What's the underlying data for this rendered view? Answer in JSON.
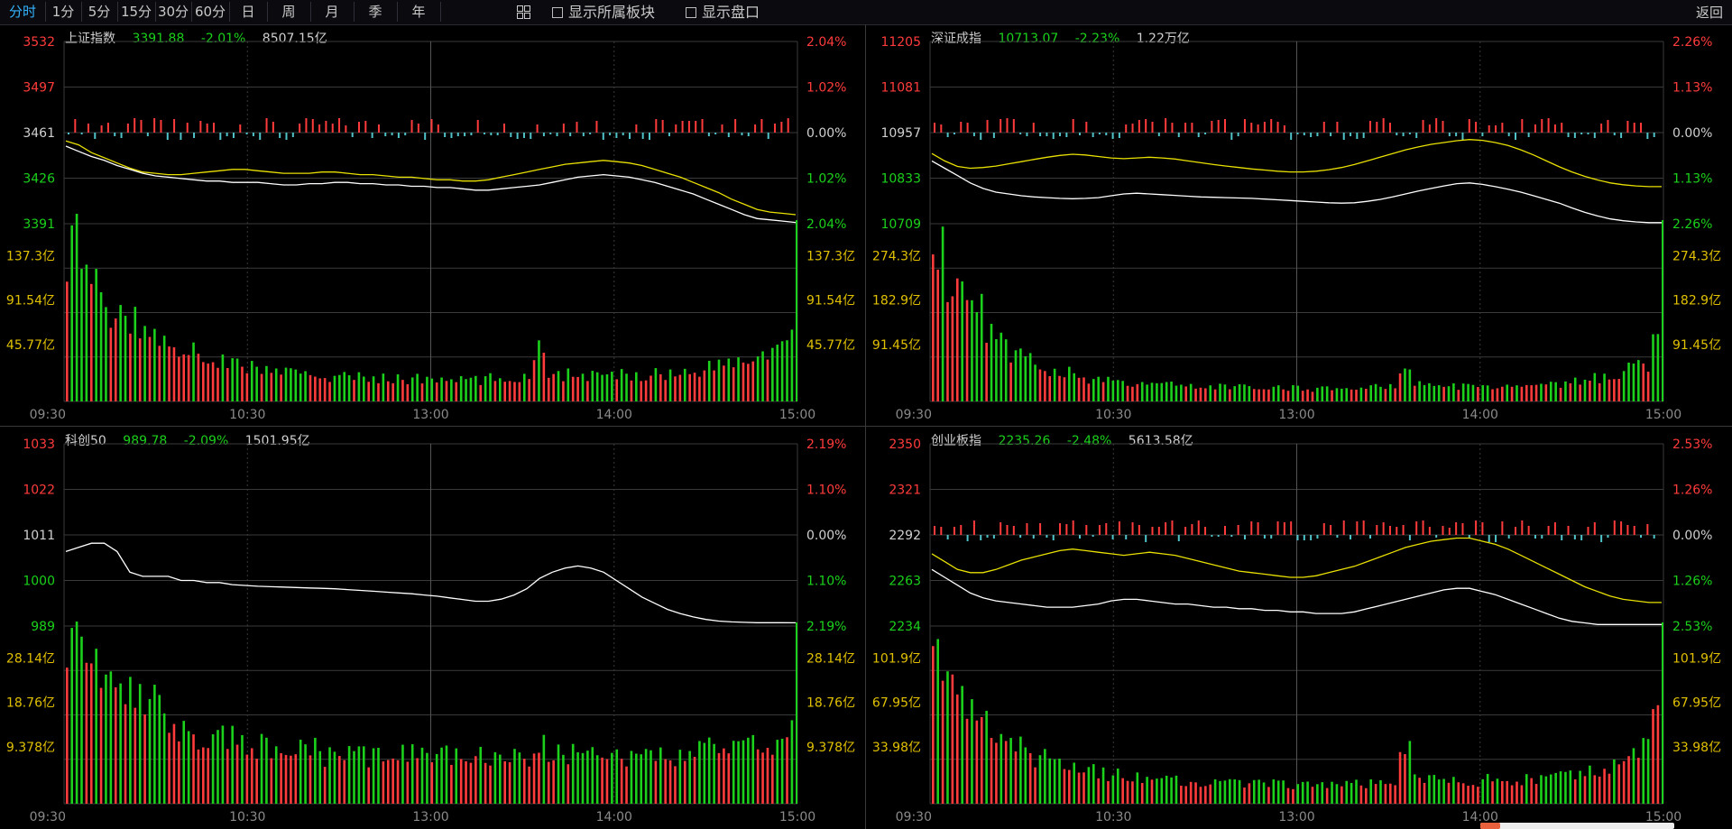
{
  "toolbar": {
    "periods": [
      "分时",
      "1分",
      "5分",
      "15分",
      "30分",
      "60分",
      "日",
      "周",
      "月",
      "季",
      "年"
    ],
    "active": "分时",
    "show_sector_label": "显示所属板块",
    "show_panel_label": "显示盘口",
    "back_label": "返回"
  },
  "colors": {
    "up": "#ff3b3b",
    "down": "#1bd11b",
    "neutral": "#d0d0d0",
    "yellow": "#e8e000",
    "white_line": "#ffffff",
    "bar_down": "#4fc3c8",
    "vol_label": "#e0c000",
    "time_label": "#8a8a8a",
    "grid": "#3a3a3a"
  },
  "panels": [
    {
      "name": "上证指数",
      "price": "3391.88",
      "change": "-2.01%",
      "amount": "8507.15亿",
      "price_labels": [
        "3532",
        "3497",
        "3461",
        "3426",
        "3391"
      ],
      "pct_labels": [
        "2.04%",
        "1.02%",
        "0.00%",
        "1.02%",
        "2.04%"
      ],
      "vol_labels": [
        "137.3亿",
        "91.54亿",
        "45.77亿"
      ],
      "time_labels": [
        "09:30",
        "10:30",
        "13:00",
        "14:00",
        "15:00"
      ],
      "has_yellow": true,
      "has_bars": true,
      "white_line": [
        3451,
        3447,
        3443,
        3440,
        3436,
        3433,
        3430,
        3428,
        3427,
        3426,
        3425,
        3424,
        3424,
        3423,
        3423,
        3423,
        3422,
        3421,
        3421,
        3422,
        3422,
        3423,
        3423,
        3422,
        3422,
        3421,
        3421,
        3420,
        3420,
        3419,
        3419,
        3418,
        3417,
        3417,
        3418,
        3419,
        3420,
        3421,
        3423,
        3425,
        3427,
        3428,
        3429,
        3428,
        3427,
        3425,
        3423,
        3420,
        3417,
        3414,
        3410,
        3406,
        3402,
        3398,
        3395,
        3394,
        3393,
        3392
      ],
      "yellow_line": [
        3455,
        3452,
        3446,
        3442,
        3438,
        3434,
        3431,
        3430,
        3429,
        3429,
        3430,
        3431,
        3432,
        3433,
        3433,
        3432,
        3431,
        3430,
        3430,
        3430,
        3431,
        3431,
        3430,
        3429,
        3429,
        3428,
        3427,
        3427,
        3426,
        3425,
        3425,
        3424,
        3424,
        3425,
        3427,
        3429,
        3431,
        3433,
        3435,
        3437,
        3438,
        3439,
        3440,
        3439,
        3438,
        3436,
        3433,
        3430,
        3427,
        3423,
        3419,
        3415,
        3410,
        3406,
        3402,
        3400,
        3399,
        3398
      ],
      "volume": [
        120,
        95,
        82,
        70,
        64,
        58,
        52,
        48,
        44,
        40,
        36,
        32,
        30,
        28,
        26,
        24,
        22,
        22,
        20,
        20,
        19,
        19,
        18,
        18,
        18,
        17,
        17,
        17,
        16,
        16,
        16,
        16,
        16,
        17,
        17,
        18,
        19,
        40,
        22,
        20,
        19,
        19,
        19,
        19,
        20,
        20,
        21,
        21,
        22,
        22,
        24,
        26,
        28,
        30,
        32,
        35,
        40,
        44
      ]
    },
    {
      "name": "深证成指",
      "price": "10713.07",
      "change": "-2.23%",
      "amount": "1.22万亿",
      "price_labels": [
        "11205",
        "11081",
        "10957",
        "10833",
        "10709"
      ],
      "pct_labels": [
        "2.26%",
        "1.13%",
        "0.00%",
        "1.13%",
        "2.26%"
      ],
      "vol_labels": [
        "274.3亿",
        "182.9亿",
        "91.45亿"
      ],
      "time_labels": [
        "09:30",
        "10:30",
        "13:00",
        "14:00",
        "15:00"
      ],
      "has_yellow": true,
      "has_bars": true,
      "white_line": [
        10880,
        10860,
        10840,
        10820,
        10805,
        10795,
        10790,
        10785,
        10782,
        10780,
        10778,
        10777,
        10778,
        10780,
        10785,
        10790,
        10792,
        10790,
        10788,
        10786,
        10784,
        10782,
        10781,
        10780,
        10779,
        10778,
        10776,
        10774,
        10772,
        10770,
        10768,
        10766,
        10765,
        10766,
        10770,
        10775,
        10782,
        10790,
        10798,
        10805,
        10812,
        10818,
        10820,
        10816,
        10810,
        10803,
        10795,
        10785,
        10775,
        10765,
        10752,
        10740,
        10730,
        10722,
        10717,
        10714,
        10712,
        10712
      ],
      "yellow_line": [
        10900,
        10880,
        10865,
        10860,
        10862,
        10866,
        10872,
        10878,
        10884,
        10890,
        10895,
        10898,
        10896,
        10892,
        10888,
        10886,
        10888,
        10890,
        10888,
        10885,
        10880,
        10875,
        10870,
        10866,
        10862,
        10858,
        10855,
        10852,
        10850,
        10850,
        10852,
        10856,
        10862,
        10870,
        10880,
        10890,
        10900,
        10910,
        10918,
        10925,
        10930,
        10935,
        10938,
        10936,
        10930,
        10922,
        10910,
        10896,
        10880,
        10864,
        10850,
        10838,
        10828,
        10820,
        10815,
        10812,
        10810,
        10810
      ],
      "volume": [
        230,
        180,
        150,
        125,
        100,
        82,
        70,
        60,
        52,
        46,
        40,
        36,
        32,
        30,
        28,
        26,
        25,
        24,
        23,
        22,
        22,
        21,
        21,
        20,
        20,
        20,
        19,
        19,
        19,
        19,
        18,
        18,
        18,
        19,
        19,
        20,
        21,
        45,
        25,
        22,
        21,
        21,
        21,
        22,
        22,
        23,
        23,
        24,
        25,
        26,
        28,
        30,
        34,
        38,
        42,
        48,
        55,
        90
      ]
    },
    {
      "name": "科创50",
      "price": "989.78",
      "change": "-2.09%",
      "amount": "1501.95亿",
      "price_labels": [
        "1033",
        "1022",
        "1011",
        "1000",
        "989"
      ],
      "pct_labels": [
        "2.19%",
        "1.10%",
        "0.00%",
        "1.10%",
        "2.19%"
      ],
      "vol_labels": [
        "28.14亿",
        "18.76亿",
        "9.378亿"
      ],
      "time_labels": [
        "09:30",
        "10:30",
        "13:00",
        "14:00",
        "15:00"
      ],
      "has_yellow": false,
      "has_bars": false,
      "white_line": [
        1007,
        1008,
        1009,
        1009,
        1007,
        1002,
        1001,
        1001,
        1001,
        1000,
        1000,
        999.5,
        999.5,
        999,
        998.8,
        998.6,
        998.5,
        998.4,
        998.3,
        998.2,
        998.1,
        998,
        997.8,
        997.6,
        997.4,
        997.2,
        997,
        996.8,
        996.5,
        996.2,
        995.8,
        995.4,
        995,
        995,
        995.5,
        996.5,
        998,
        1000.5,
        1002,
        1003,
        1003.5,
        1003,
        1002,
        1000,
        998,
        996,
        994.5,
        993,
        992,
        991.2,
        990.6,
        990.2,
        990,
        989.9,
        989.8,
        989.8,
        989.8,
        989.78
      ],
      "yellow_line": [],
      "volume": [
        20,
        19,
        17,
        15,
        14,
        13,
        12,
        11,
        10,
        9,
        9,
        8,
        8,
        8,
        7,
        7,
        7,
        7,
        7,
        7,
        6,
        6,
        6,
        6,
        6,
        6,
        6,
        6,
        6,
        6,
        6,
        6,
        6,
        6,
        6,
        6,
        6,
        7,
        6,
        6,
        6,
        6,
        6,
        6,
        6,
        6,
        6,
        6,
        6,
        6,
        7,
        7,
        7,
        7,
        7,
        8,
        8,
        9
      ]
    },
    {
      "name": "创业板指",
      "price": "2235.26",
      "change": "-2.48%",
      "amount": "5613.58亿",
      "price_labels": [
        "2350",
        "2321",
        "2292",
        "2263",
        "2234"
      ],
      "pct_labels": [
        "2.53%",
        "1.26%",
        "0.00%",
        "1.26%",
        "2.53%"
      ],
      "vol_labels": [
        "101.9亿",
        "67.95亿",
        "33.98亿"
      ],
      "time_labels": [
        "09:30",
        "10:30",
        "13:00",
        "14:00",
        "15:00"
      ],
      "has_yellow": true,
      "has_bars": true,
      "white_line": [
        2270,
        2265,
        2260,
        2255,
        2252,
        2250,
        2249,
        2248,
        2247,
        2246,
        2246,
        2246,
        2247,
        2248,
        2250,
        2251,
        2251,
        2250,
        2249,
        2248,
        2248,
        2247,
        2246,
        2246,
        2245,
        2245,
        2244,
        2244,
        2243,
        2243,
        2242,
        2242,
        2242,
        2243,
        2245,
        2247,
        2249,
        2251,
        2253,
        2255,
        2257,
        2258,
        2258,
        2256,
        2254,
        2251,
        2248,
        2245,
        2242,
        2239,
        2237,
        2236,
        2235,
        2235,
        2235,
        2235,
        2235,
        2235
      ],
      "yellow_line": [
        2280,
        2275,
        2270,
        2268,
        2268,
        2270,
        2273,
        2276,
        2278,
        2280,
        2282,
        2283,
        2282,
        2281,
        2280,
        2279,
        2280,
        2281,
        2280,
        2279,
        2277,
        2275,
        2273,
        2271,
        2269,
        2268,
        2267,
        2266,
        2265,
        2265,
        2266,
        2268,
        2270,
        2272,
        2275,
        2278,
        2281,
        2284,
        2286,
        2288,
        2289,
        2290,
        2290,
        2288,
        2286,
        2283,
        2279,
        2275,
        2271,
        2267,
        2263,
        2259,
        2256,
        2253,
        2251,
        2250,
        2249,
        2249
      ],
      "volume": [
        85,
        70,
        60,
        50,
        42,
        36,
        32,
        28,
        25,
        22,
        20,
        18,
        17,
        16,
        15,
        14,
        14,
        13,
        13,
        12,
        12,
        12,
        12,
        11,
        11,
        11,
        11,
        11,
        10,
        10,
        10,
        10,
        10,
        11,
        11,
        12,
        12,
        28,
        14,
        13,
        12,
        12,
        12,
        12,
        13,
        13,
        13,
        14,
        14,
        15,
        16,
        17,
        19,
        21,
        23,
        26,
        30,
        55
      ]
    }
  ]
}
